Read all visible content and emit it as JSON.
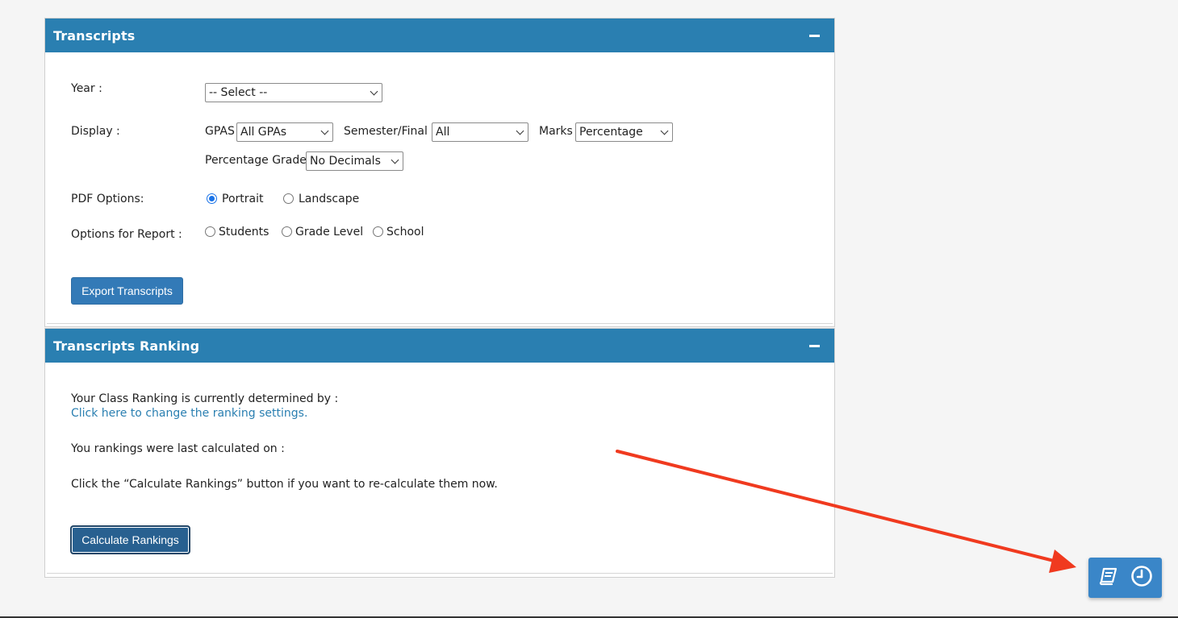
{
  "transcripts": {
    "title": "Transcripts",
    "year": {
      "label": "Year :",
      "selected": "-- Select --"
    },
    "display": {
      "label": "Display :",
      "gpas_label": "GPAS",
      "gpas_selected": "All GPAs",
      "semester_label": "Semester/Final",
      "semester_selected": "All",
      "marks_label": "Marks",
      "marks_selected": "Percentage",
      "percentage_grade_label": "Percentage Grade",
      "percentage_grade_selected": "No Decimals"
    },
    "pdf_options": {
      "label": "PDF Options:",
      "portrait": "Portrait",
      "landscape": "Landscape",
      "selected": "Portrait"
    },
    "report_options": {
      "label": "Options for Report :",
      "students": "Students",
      "grade_level": "Grade Level",
      "school": "School"
    },
    "export_button": "Export Transcripts"
  },
  "ranking": {
    "title": "Transcripts Ranking",
    "determined_by": "Your Class Ranking is currently determined by :",
    "change_link": "Click here to change the ranking settings.",
    "last_calculated": "You rankings were last calculated on :",
    "instruction": "Click the “Calculate Rankings” button if you want to re-calculate them now.",
    "calculate_button": "Calculate Rankings"
  },
  "floating_widget": {
    "icons": [
      "book-icon",
      "clock-icon"
    ]
  },
  "colors": {
    "header": "#2a7fb1",
    "button": "#337ab7",
    "annotation_arrow": "#f03a1f"
  }
}
